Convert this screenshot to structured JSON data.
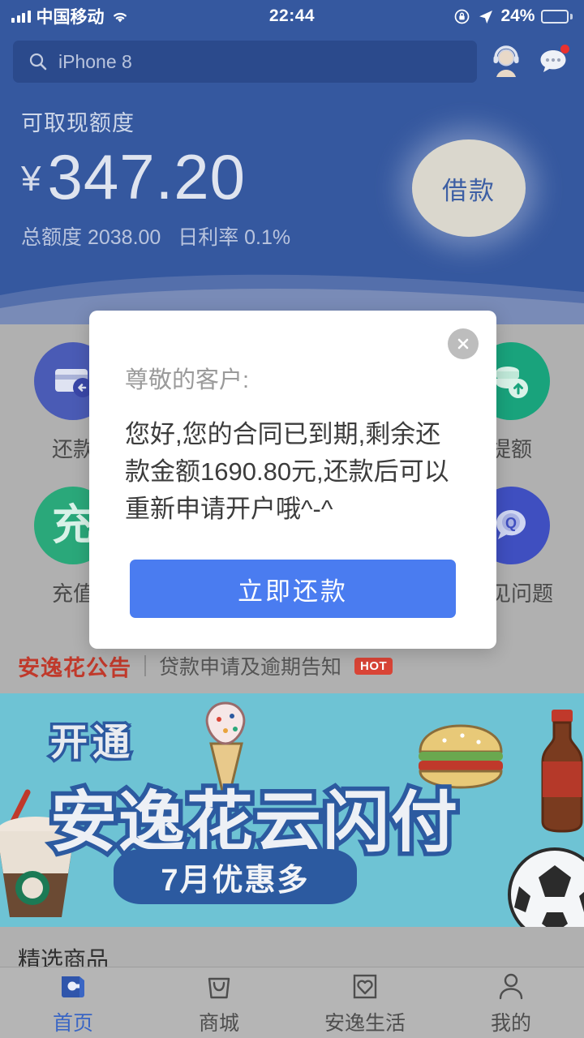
{
  "status_bar": {
    "carrier": "中国移动",
    "time": "22:44",
    "battery_percent": "24%",
    "signal_icon": "signal-bars-icon",
    "wifi_icon": "wifi-icon",
    "rotation_lock_icon": "rotation-lock-icon",
    "location_icon": "location-arrow-icon",
    "battery_icon": "battery-icon"
  },
  "header": {
    "search_placeholder": "iPhone 8",
    "search_icon": "search-icon",
    "service_icon": "customer-service-icon",
    "message_icon": "message-bubble-icon",
    "credit_label": "可取现额度",
    "currency_symbol": "¥",
    "available_amount": "347.20",
    "total_label": "总额度",
    "total_amount": "2038.00",
    "rate_label": "日利率",
    "rate_value": "0.1%",
    "borrow_button": "借款",
    "background_color": "#35589f"
  },
  "quick_actions": [
    {
      "label": "还款",
      "icon": "credit-card-return-icon",
      "color": "#4a5bb5"
    },
    {
      "label": "提额",
      "icon": "coins-up-icon",
      "color": "#19a37c"
    },
    {
      "label": "充值",
      "icon": "recharge-icon",
      "color": "#2aa87a"
    },
    {
      "label": "常见问题",
      "icon": "question-bubble-icon",
      "color": "#3f4fc0"
    }
  ],
  "notice": {
    "brand": "安逸花公告",
    "text": "贷款申请及逾期告知",
    "badge": "HOT",
    "badge_color": "#d94436",
    "brand_color": "#c0392b"
  },
  "banner": {
    "line1": "开通",
    "line2": "安逸花云闪付",
    "line3": "7月优惠多",
    "background_color": "#6ec3d4",
    "text_outline_color": "#2c5aa0",
    "art_icons": [
      "ice-cream-icon",
      "burger-icon",
      "cola-bottle-icon",
      "coffee-cup-icon",
      "soccer-ball-icon"
    ]
  },
  "featured": {
    "title": "精选商品"
  },
  "modal": {
    "close_icon": "close-icon",
    "greeting": "尊敬的客户:",
    "message": "您好,您的合同已到期,剩余还款金额1690.80元,还款后可以重新申请开户哦^-^",
    "button_label": "立即还款",
    "button_color": "#4a7cf0"
  },
  "tabbar": [
    {
      "label": "首页",
      "icon": "wallet-icon",
      "active": true
    },
    {
      "label": "商城",
      "icon": "shopping-bag-icon",
      "active": false
    },
    {
      "label": "安逸生活",
      "icon": "heart-square-icon",
      "active": false
    },
    {
      "label": "我的",
      "icon": "person-icon",
      "active": false
    }
  ]
}
